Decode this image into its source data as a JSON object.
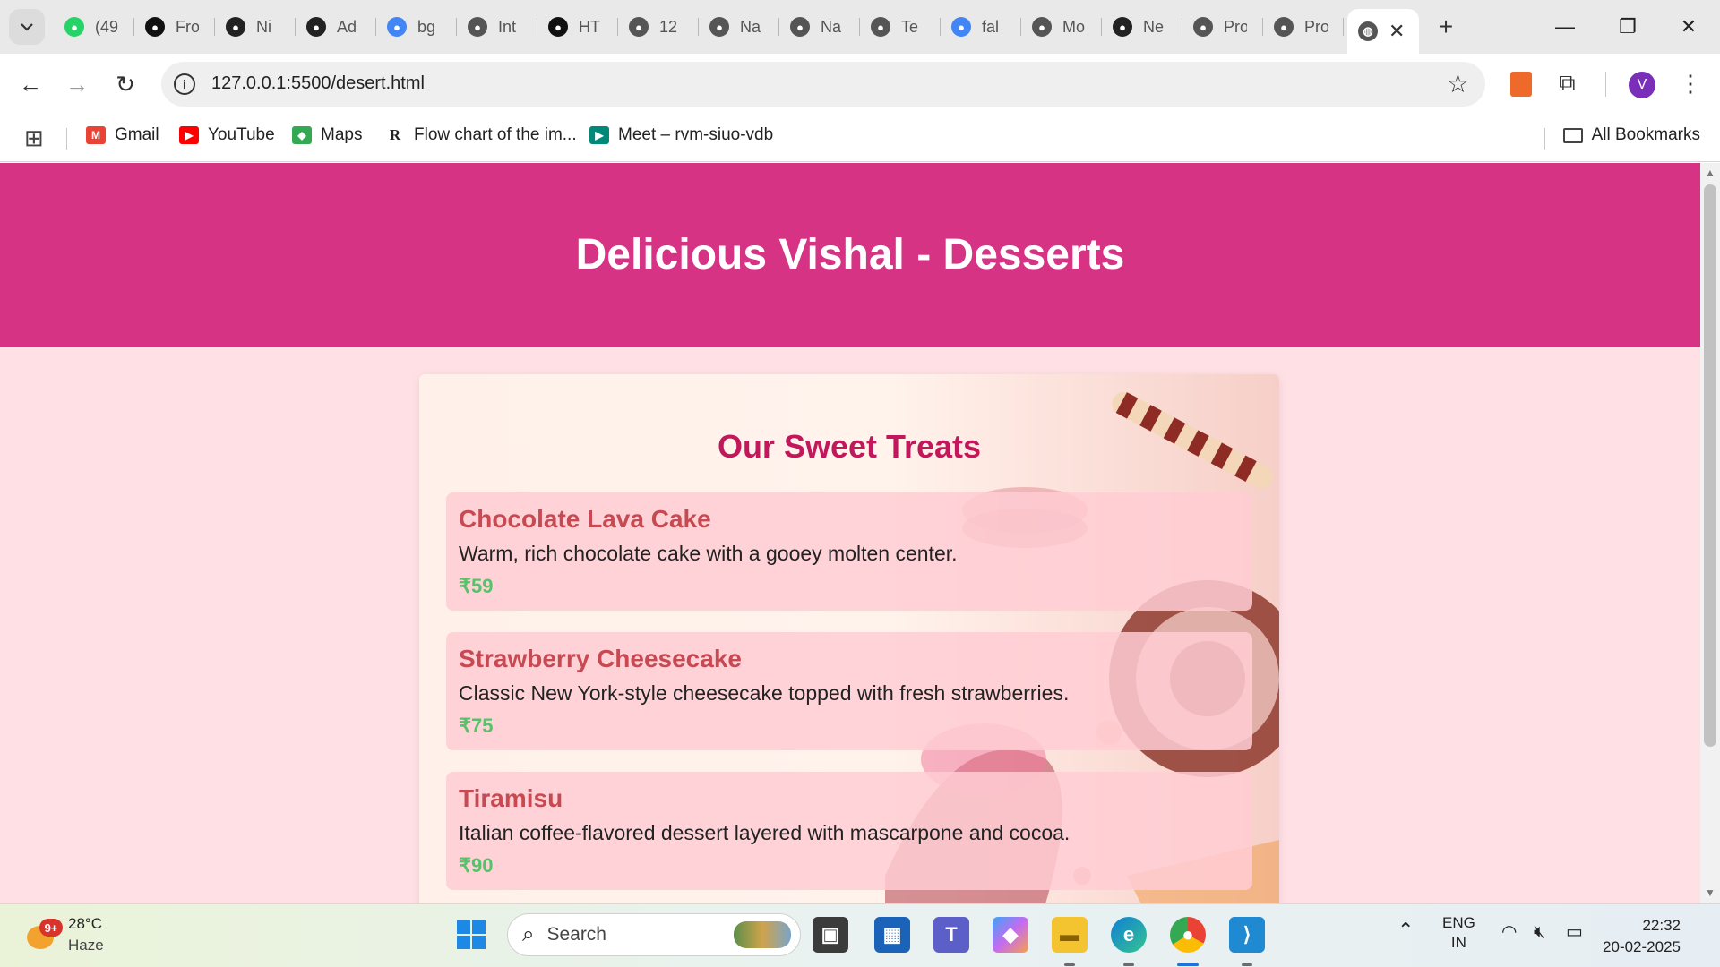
{
  "browser": {
    "tabs": [
      {
        "label": "(49",
        "icon": "whatsapp-icon",
        "color": "#25d366"
      },
      {
        "label": "Fro",
        "icon": "notion-icon",
        "color": "#111111"
      },
      {
        "label": "Ni",
        "icon": "github-icon",
        "color": "#222222"
      },
      {
        "label": "Ad",
        "icon": "github-icon",
        "color": "#222222"
      },
      {
        "label": "bg",
        "icon": "google-icon",
        "color": "#4285f4"
      },
      {
        "label": "Int",
        "icon": "globe-icon",
        "color": "#555555"
      },
      {
        "label": "HT",
        "icon": "openai-icon",
        "color": "#111111"
      },
      {
        "label": "12",
        "icon": "globe-icon",
        "color": "#555555"
      },
      {
        "label": "Na",
        "icon": "globe-icon",
        "color": "#555555"
      },
      {
        "label": "Na",
        "icon": "globe-icon",
        "color": "#555555"
      },
      {
        "label": "Te",
        "icon": "globe-icon",
        "color": "#555555"
      },
      {
        "label": "fal",
        "icon": "google-icon",
        "color": "#4285f4"
      },
      {
        "label": "Mo",
        "icon": "globe-icon",
        "color": "#555555"
      },
      {
        "label": "Ne",
        "icon": "github-icon",
        "color": "#222222"
      },
      {
        "label": "Pro",
        "icon": "globe-icon",
        "color": "#555555"
      },
      {
        "label": "Pro",
        "icon": "globe-icon",
        "color": "#555555"
      }
    ],
    "active_tab_icon": "globe-icon",
    "url": "127.0.0.1:5500/desert.html",
    "profile_initial": "V",
    "bookmarks": [
      {
        "label": "Gmail",
        "icon": "gmail-icon",
        "color": "#ea4335"
      },
      {
        "label": "YouTube",
        "icon": "youtube-icon",
        "color": "#ff0000"
      },
      {
        "label": "Maps",
        "icon": "maps-icon",
        "color": "#34a853"
      },
      {
        "label": "Flow chart of the im...",
        "icon": "researchgate-icon",
        "color": "#222222"
      },
      {
        "label": "Meet – rvm-siuo-vdb",
        "icon": "meet-icon",
        "color": "#00897b"
      }
    ],
    "all_bookmarks": "All Bookmarks"
  },
  "page": {
    "title": "Delicious Vishal - Desserts",
    "section_title": "Our Sweet Treats",
    "items": [
      {
        "name": "Chocolate Lava Cake",
        "description": "Warm, rich chocolate cake with a gooey molten center.",
        "price": "₹59"
      },
      {
        "name": "Strawberry Cheesecake",
        "description": "Classic New York-style cheesecake topped with fresh strawberries.",
        "price": "₹75"
      },
      {
        "name": "Tiramisu",
        "description": "Italian coffee-flavored dessert layered with mascarpone and cocoa.",
        "price": "₹90"
      }
    ],
    "colors": {
      "header": "#d63384",
      "section_title": "#c2185b",
      "item_name": "#c74a52",
      "price": "#57c26a",
      "background": "#ffe0e5"
    }
  },
  "taskbar": {
    "weather": {
      "temp": "28°C",
      "condition": "Haze",
      "badge": "9+"
    },
    "search_placeholder": "Search",
    "language": {
      "line1": "ENG",
      "line2": "IN"
    },
    "time": "22:32",
    "date": "20-02-2025"
  }
}
